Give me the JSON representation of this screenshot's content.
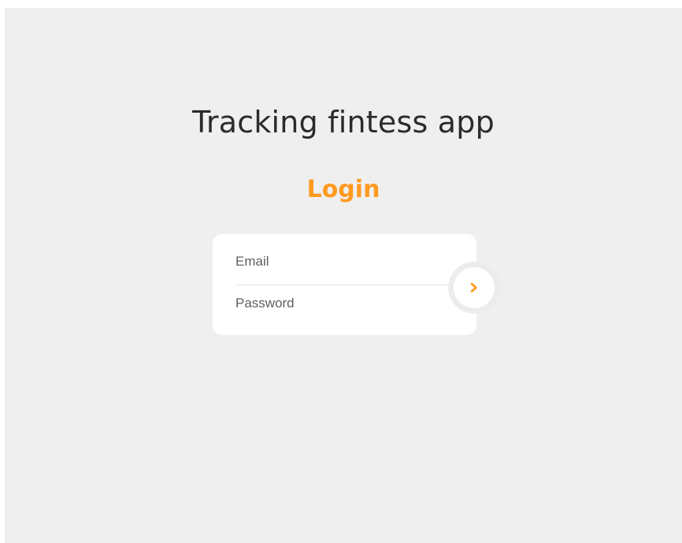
{
  "app": {
    "title": "Tracking fintess app"
  },
  "login": {
    "heading": "Login",
    "email_placeholder": "Email",
    "password_placeholder": "Password",
    "submit_icon": "chevron-right-icon"
  },
  "colors": {
    "accent": "#ff9a1f",
    "background": "#efefef",
    "card": "#ffffff",
    "text": "#2b2b2b"
  }
}
